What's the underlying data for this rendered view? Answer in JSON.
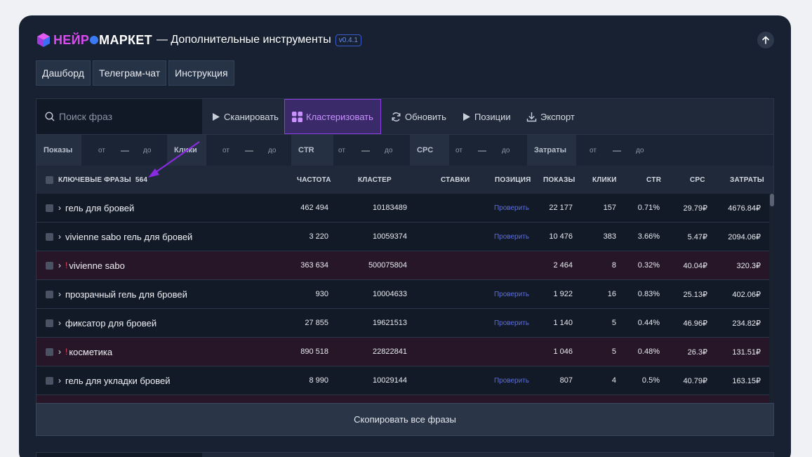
{
  "app": {
    "logo_part1": "НЕЙР",
    "logo_part2": "МАРКЕТ",
    "title_rest": "— Дополнительные инструменты",
    "version": "v0.4.1"
  },
  "nav": [
    "Дашборд",
    "Телеграм-чат",
    "Инструкция"
  ],
  "toolbar": {
    "search_placeholder": "Поиск фраз",
    "scan": "Сканировать",
    "cluster": "Кластеризовать",
    "refresh": "Обновить",
    "positions": "Позиции",
    "export": "Экспорт"
  },
  "filters": {
    "from": "от",
    "to": "до",
    "dash": "—",
    "labels": [
      "Показы",
      "Клики",
      "CTR",
      "CPC",
      "Затраты"
    ]
  },
  "table": {
    "keywords_header": "КЛЮЧЕВЫЕ ФРАЗЫ",
    "count": "564",
    "columns": [
      "ЧАСТОТА",
      "КЛАСТЕР",
      "СТАВКИ",
      "ПОЗИЦИЯ",
      "ПОКАЗЫ",
      "КЛИКИ",
      "CTR",
      "CPC",
      "ЗАТРАТЫ"
    ],
    "check_label": "Проверить",
    "rows": [
      {
        "phrase": "гель для бровей",
        "negative": false,
        "freq": "462 494",
        "cluster": "10183489",
        "position": "Проверить",
        "shows": "22 177",
        "clicks": "157",
        "ctr": "0.71%",
        "cpc": "29.79₽",
        "cost": "4676.84₽"
      },
      {
        "phrase": "vivienne sabo гель для бровей",
        "negative": false,
        "freq": "3 220",
        "cluster": "10059374",
        "position": "Проверить",
        "shows": "10 476",
        "clicks": "383",
        "ctr": "3.66%",
        "cpc": "5.47₽",
        "cost": "2094.06₽"
      },
      {
        "phrase": "vivienne sabo",
        "negative": true,
        "freq": "363 634",
        "cluster": "500075804",
        "position": "",
        "shows": "2 464",
        "clicks": "8",
        "ctr": "0.32%",
        "cpc": "40.04₽",
        "cost": "320.3₽"
      },
      {
        "phrase": "прозрачный гель для бровей",
        "negative": false,
        "freq": "930",
        "cluster": "10004633",
        "position": "Проверить",
        "shows": "1 922",
        "clicks": "16",
        "ctr": "0.83%",
        "cpc": "25.13₽",
        "cost": "402.06₽"
      },
      {
        "phrase": "фиксатор для бровей",
        "negative": false,
        "freq": "27 855",
        "cluster": "19621513",
        "position": "Проверить",
        "shows": "1 140",
        "clicks": "5",
        "ctr": "0.44%",
        "cpc": "46.96₽",
        "cost": "234.82₽"
      },
      {
        "phrase": "косметика",
        "negative": true,
        "freq": "890 518",
        "cluster": "22822841",
        "position": "",
        "shows": "1 046",
        "clicks": "5",
        "ctr": "0.48%",
        "cpc": "26.3₽",
        "cost": "131.51₽"
      },
      {
        "phrase": "гель для укладки бровей",
        "negative": false,
        "freq": "8 990",
        "cluster": "10029144",
        "position": "Проверить",
        "shows": "807",
        "clicks": "4",
        "ctr": "0.5%",
        "cpc": "40.79₽",
        "cost": "163.15₽"
      }
    ]
  },
  "copy_all": "Скопировать все фразы",
  "colors": {
    "accent": "#8a3fe0",
    "negative_row": "#261628",
    "link": "#5a6ee0"
  }
}
